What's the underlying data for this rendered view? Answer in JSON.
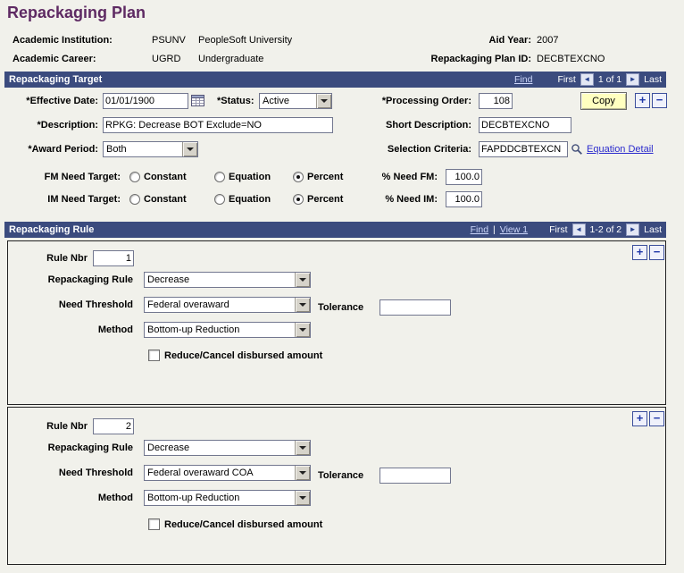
{
  "page": {
    "title": "Repackaging Plan"
  },
  "header": {
    "academic_institution": {
      "label": "Academic Institution:",
      "value": "PSUNV",
      "desc": "PeopleSoft University"
    },
    "academic_career": {
      "label": "Academic Career:",
      "value": "UGRD",
      "desc": "Undergraduate"
    },
    "aid_year": {
      "label": "Aid Year:",
      "value": "2007"
    },
    "repackaging_plan_id": {
      "label": "Repackaging Plan ID:",
      "value": "DECBTEXCNO"
    }
  },
  "target": {
    "title": "Repackaging Target",
    "nav": {
      "find": "Find",
      "first": "First",
      "count": "1 of 1",
      "last": "Last",
      "prev": "◄",
      "next": "►"
    },
    "effective_date": {
      "label": "*Effective Date:",
      "value": "01/01/1900"
    },
    "status": {
      "label": "*Status:",
      "value": "Active"
    },
    "processing_order": {
      "label": "*Processing Order:",
      "value": "108"
    },
    "copy_label": "Copy",
    "add_label": "+",
    "delete_label": "−",
    "description": {
      "label": "*Description:",
      "value": "RPKG: Decrease BOT Exclude=NO"
    },
    "short_description": {
      "label": "Short Description:",
      "value": "DECBTEXCNO"
    },
    "award_period": {
      "label": "*Award Period:",
      "value": "Both"
    },
    "selection_criteria": {
      "label": "Selection Criteria:",
      "value": "FAPDDCBTEXCN"
    },
    "equation_detail": "Equation Detail",
    "radio_options": [
      "Constant",
      "Equation",
      "Percent"
    ],
    "fm": {
      "label": "FM Need Target:",
      "selected": "Percent"
    },
    "im": {
      "label": "IM Need Target:",
      "selected": "Percent"
    },
    "pct_fm": {
      "label": "% Need FM:",
      "value": "100.0"
    },
    "pct_im": {
      "label": "% Need IM:",
      "value": "100.0"
    }
  },
  "rules": {
    "title": "Repackaging Rule",
    "nav": {
      "find": "Find",
      "sep": "|",
      "view": "View 1",
      "first": "First",
      "count": "1-2 of 2",
      "last": "Last",
      "prev": "◄",
      "next": "►"
    },
    "labels": {
      "rule_nbr": "Rule Nbr",
      "repackaging_rule": "Repackaging Rule",
      "need_threshold": "Need Threshold",
      "tolerance": "Tolerance",
      "method": "Method",
      "reduce_cancel": "Reduce/Cancel disbursed amount"
    },
    "add_label": "+",
    "delete_label": "−",
    "rows": [
      {
        "rule_nbr": "1",
        "repackaging_rule": "Decrease",
        "need_threshold": "Federal overaward",
        "tolerance": "",
        "method": "Bottom-up Reduction"
      },
      {
        "rule_nbr": "2",
        "repackaging_rule": "Decrease",
        "need_threshold": "Federal overaward COA",
        "tolerance": "",
        "method": "Bottom-up Reduction"
      }
    ]
  }
}
